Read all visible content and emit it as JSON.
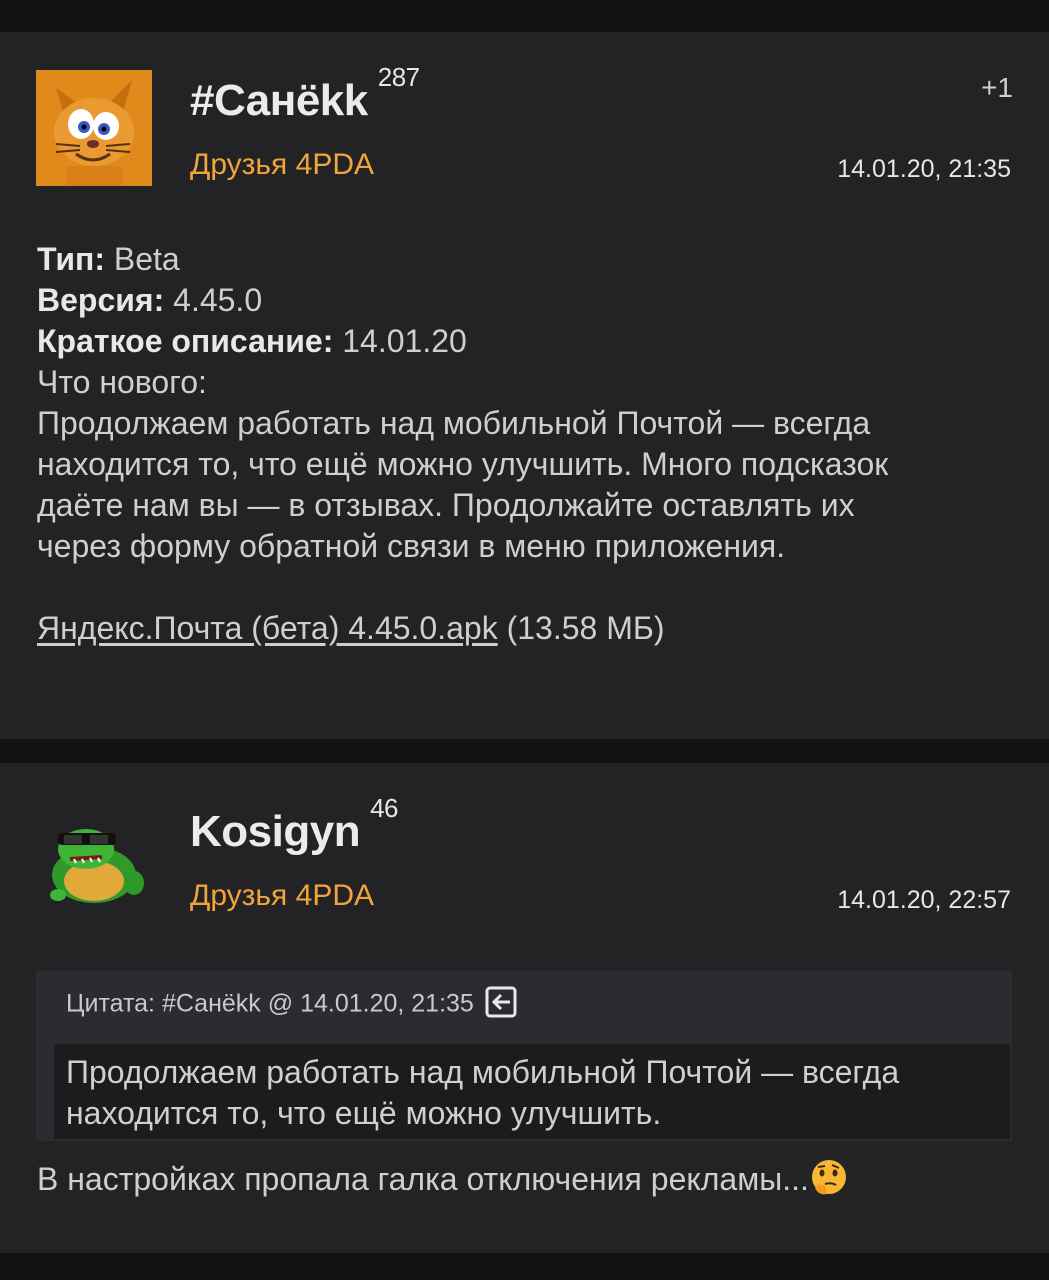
{
  "posts": [
    {
      "nick": "#Санёkk",
      "reputation": "287",
      "group": "Друзья 4PDA",
      "karma": "+1",
      "date": "14.01.20, 21:35",
      "avatar_icon": "cat-avatar-icon",
      "body": {
        "type_label": "Тип:",
        "type_value": "Beta",
        "version_label": "Версия:",
        "version_value": "4.45.0",
        "desc_label": "Краткое описание:",
        "desc_value": "14.01.20",
        "lines": [
          "Что нового:",
          "Продолжаем работать над мобильной Почтой — всегда",
          "находится то, что ещё можно улучшить. Много подсказок",
          "даёте нам вы — в отзывах. Продолжайте оставлять их",
          "через форму обратной связи в меню приложения."
        ],
        "attachment_link": "Яндекс.Почта (бета) 4.45.0.apk",
        "attachment_size": "(13.58 МБ)"
      }
    },
    {
      "nick": "Kosigyn",
      "reputation": "46",
      "group": "Друзья 4PDA",
      "date": "14.01.20, 22:57",
      "avatar_icon": "turtle-avatar-icon",
      "quote": {
        "header": "Цитата: #Санёkk @ 14.01.20, 21:35",
        "jump_icon": "jump-to-post-icon",
        "lines": [
          "Продолжаем работать над мобильной Почтой — всегда",
          "находится то, что ещё можно улучшить."
        ]
      },
      "reply_text": "В настройках пропала галка отключения рекламы...",
      "reply_emoji": "thinking-face-emoji"
    }
  ],
  "colors": {
    "page_bg": "#121214",
    "post_bg": "#232326",
    "group": "#f0a43a",
    "quote_bg": "#2c2c30",
    "quote_body_bg": "#1c1c1f"
  }
}
